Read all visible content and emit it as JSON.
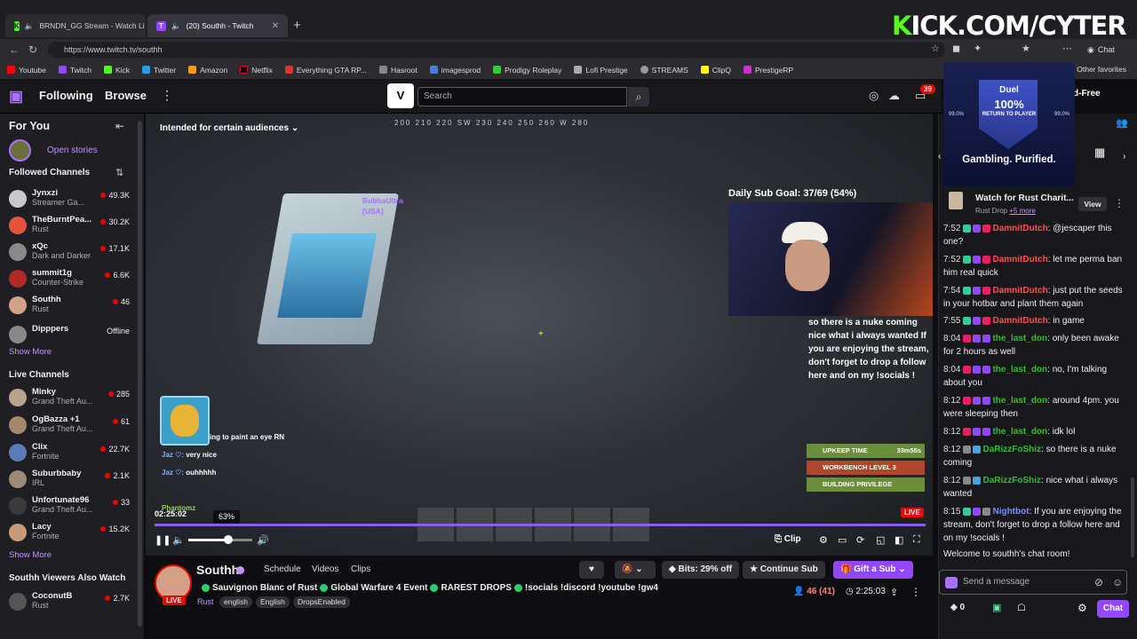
{
  "browser": {
    "tabs": [
      {
        "label": "BRNDN_GG Stream - Watch Li",
        "favicon": "K"
      },
      {
        "label": "(20) Southh - Twitch",
        "favicon": "T"
      }
    ],
    "new_tab": "+",
    "overlay_brand_prefix": "K",
    "overlay_brand_rest": "ICK.COM/CYTER",
    "url": "https://www.twitch.tv/southh",
    "chat_button": "Chat",
    "bookmarks": [
      "Youtube",
      "Twitch",
      "Kick",
      "Twitter",
      "Amazon",
      "Netflix",
      "Everything GTA RP...",
      "Hasroot",
      "imagesprod",
      "Prodigy Roleplay",
      "Lofi Prestige",
      "STREAMS",
      "ClipQ",
      "PrestigeRP"
    ],
    "other_favorites": "Other favorites"
  },
  "twitch_nav": {
    "following": "Following",
    "browse": "Browse",
    "more": "⋮",
    "search_placeholder": "Search",
    "notifications": "39",
    "ad_free_fragment": "d-Free"
  },
  "sidebar": {
    "for_you": "For You",
    "open_stories": "Open stories",
    "followed_title": "Followed Channels",
    "followed": [
      {
        "name": "Jynxzi",
        "game": "Streamer Ga...",
        "viewers": "49.3K",
        "color": "#c9c9c9"
      },
      {
        "name": "TheBurntPea...",
        "game": "Rust",
        "viewers": "30.2K",
        "color": "#e4523a"
      },
      {
        "name": "xQc",
        "game": "Dark and Darker",
        "viewers": "17.1K",
        "color": "#8a8a8a"
      },
      {
        "name": "summit1g",
        "game": "Counter-Strike",
        "viewers": "6.6K",
        "color": "#b02a2a"
      },
      {
        "name": "Southh",
        "game": "Rust",
        "viewers": "46",
        "color": "#d4a087"
      },
      {
        "name": "Dipppers",
        "game": "",
        "viewers": "Offline",
        "color": "#888888"
      }
    ],
    "show_more_1": "Show More",
    "live_title": "Live Channels",
    "live": [
      {
        "name": "Minky",
        "game": "Grand Theft Au...",
        "viewers": "285",
        "color": "#b9a58c"
      },
      {
        "name": "OgBazza +1",
        "game": "Grand Theft Au...",
        "viewers": "61",
        "color": "#a4876c"
      },
      {
        "name": "Clix",
        "game": "Fortnite",
        "viewers": "22.7K",
        "color": "#5a7ab8"
      },
      {
        "name": "Suburbbaby",
        "game": "IRL",
        "viewers": "2.1K",
        "color": "#9c8b7a"
      },
      {
        "name": "Unfortunate96",
        "game": "Grand Theft Au...",
        "viewers": "33",
        "color": "#3b3b3b"
      },
      {
        "name": "Lacy",
        "game": "Fortnite",
        "viewers": "15.2K",
        "color": "#c79a7a"
      }
    ],
    "show_more_2": "Show More",
    "also_watch_title": "Southh Viewers Also Watch",
    "also_watch": [
      {
        "name": "CoconutB",
        "game": "Rust",
        "viewers": "2.7K",
        "color": "#555555"
      }
    ]
  },
  "video": {
    "audience_label": "Intended for certain audiences",
    "compass": "200  210  220 SW 230     240    250    260    W    280",
    "player_tag_1": "BubbaUltra",
    "player_tag_2": "[USA]",
    "sub_goal": "Daily Sub Goal: 37/69 (54%)",
    "overlay_chat": "so there is a nuke coming nice what i always wanted If you are enjoying the stream, don't forget to drop a follow here and on my !socials !",
    "hud": [
      {
        "label": "UPKEEP TIME",
        "value": "33m55s",
        "color": "#6b8e3a"
      },
      {
        "label": "WORKBENCH LEVEL 3",
        "value": "",
        "color": "#b0472d"
      },
      {
        "label": "BUILDING PRIVILEGE",
        "value": "",
        "color": "#6b8e3a"
      }
    ],
    "game_chat": [
      {
        "user": "",
        "text": "ing to paint an eye RN"
      },
      {
        "user": "Jaz ♡:",
        "text": "very nice"
      },
      {
        "user": "Jaz ♡:",
        "text": "ouhhhhh"
      }
    ],
    "game_tag": "Phantomz",
    "timestamp": "02:25:02",
    "volume_label": "63%",
    "volume": 0.63,
    "clip": "Clip",
    "live": "LIVE"
  },
  "channel": {
    "name": "Southh",
    "tabs": [
      "Schedule",
      "Videos",
      "Clips"
    ],
    "title": "Sauvignon Blanc of Rust",
    "title_parts": [
      "Global Warfare 4 Event",
      "RAREST DROPS",
      "!socials !discord !youtube !gw4"
    ],
    "game": "Rust",
    "tags": [
      "english",
      "English",
      "DropsEnabled"
    ],
    "bits": "Bits: 29% off",
    "continue_sub": "Continue Sub",
    "gift_sub": "Gift a Sub",
    "viewers": "46 (41)",
    "uptime": "2:25:03",
    "live": "LIVE"
  },
  "chat": {
    "ad": {
      "duel": "Duel",
      "pct": "100%",
      "sub": "RETURN TO PLAYER",
      "left": "99.0%",
      "right": "99.0%",
      "tagline": "Gambling. Purified."
    },
    "drop": {
      "title": "Watch for Rust Charit...",
      "sub": "Rust Drop",
      "more": "+5 more",
      "view": "View"
    },
    "messages": [
      {
        "time": "7:52",
        "user": "DamnitDutch",
        "color": "#ff4f4f",
        "text": "@jescaper this one?"
      },
      {
        "time": "7:52",
        "user": "DamnitDutch",
        "color": "#ff4f4f",
        "text": "let me perma ban him real quick"
      },
      {
        "time": "7:54",
        "user": "DamnitDutch",
        "color": "#ff4f4f",
        "text": "just put the seeds in your hotbar and plant them again"
      },
      {
        "time": "7:55",
        "user": "DamnitDutch",
        "color": "#ff4f4f",
        "text": "in game"
      },
      {
        "time": "8:04",
        "user": "the_last_don",
        "color": "#2fbf2f",
        "text": "only been awake for 2 hours as well"
      },
      {
        "time": "8:04",
        "user": "the_last_don",
        "color": "#2fbf2f",
        "text": "no, I'm talking about you"
      },
      {
        "time": "8:12",
        "user": "the_last_don",
        "color": "#2fbf2f",
        "text": "around 4pm. you were sleeping then"
      },
      {
        "time": "8:12",
        "user": "the_last_don",
        "color": "#2fbf2f",
        "text": "idk lol"
      },
      {
        "time": "8:12",
        "user": "DaRizzFoShiz",
        "color": "#2fbf2f",
        "text": "so there is a nuke coming"
      },
      {
        "time": "8:12",
        "user": "DaRizzFoShiz",
        "color": "#2fbf2f",
        "text": "nice what i always wanted"
      },
      {
        "time": "8:15",
        "user": "Nightbot",
        "color": "#7b8cff",
        "text": "If you are enjoying the stream, don't forget to drop a follow here and on my !socials !"
      }
    ],
    "welcome": "Welcome to southh's chat room!",
    "input_placeholder": "Send a message",
    "points": "0",
    "chat_button": "Chat"
  }
}
